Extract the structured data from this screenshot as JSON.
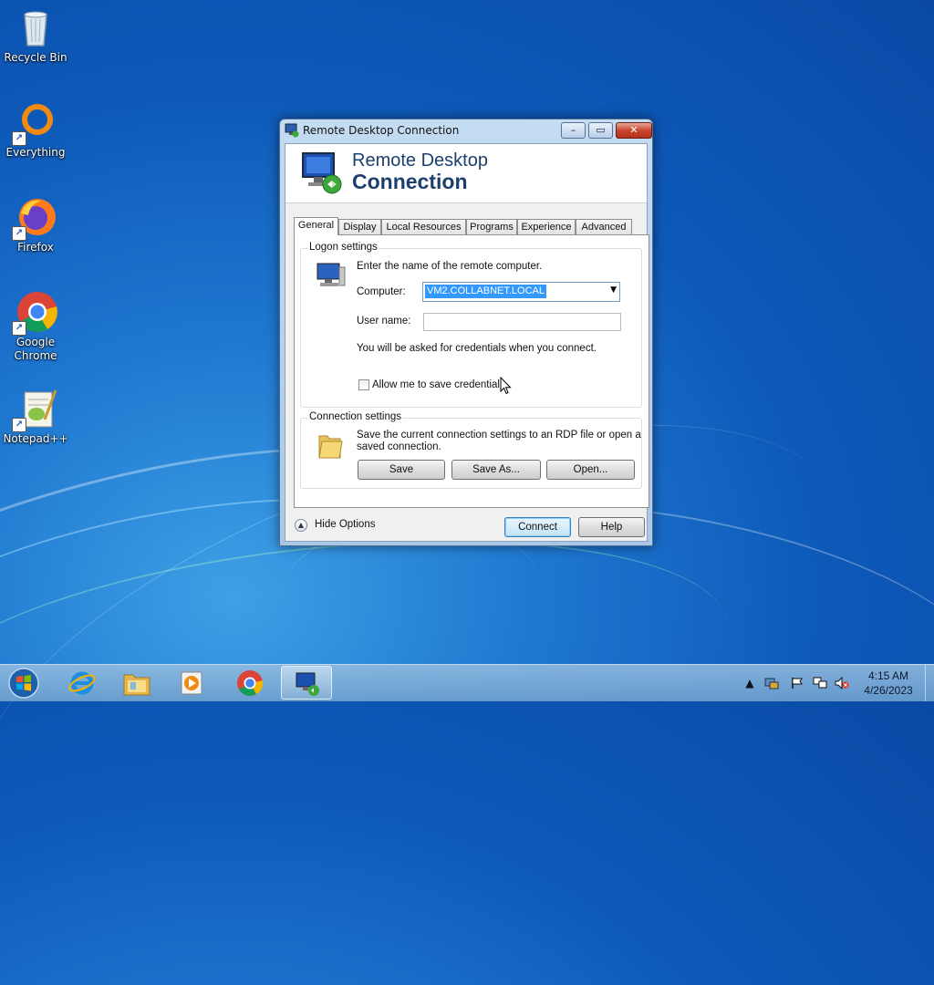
{
  "desktop": {
    "icons": [
      {
        "label": "Recycle Bin"
      },
      {
        "label": "Everything"
      },
      {
        "label": "Firefox"
      },
      {
        "label": "Google Chrome"
      },
      {
        "label": "Notepad++"
      }
    ]
  },
  "window": {
    "title": "Remote Desktop Connection",
    "minimize_glyph": "–",
    "maximize_glyph": "▭",
    "close_glyph": "✕",
    "banner_line1": "Remote Desktop",
    "banner_line2": "Connection",
    "tabs": [
      {
        "label": "General",
        "active": true
      },
      {
        "label": "Display"
      },
      {
        "label": "Local Resources"
      },
      {
        "label": "Programs"
      },
      {
        "label": "Experience"
      },
      {
        "label": "Advanced"
      }
    ],
    "logon": {
      "group_label": "Logon settings",
      "instruction": "Enter the name of the remote computer.",
      "computer_label": "Computer:",
      "computer_value": "VM2.COLLABNET.LOCAL",
      "username_label": "User name:",
      "username_value": "",
      "credentials_note": "You will be asked for credentials when you connect.",
      "allow_save_label": "Allow me to save credentials",
      "allow_save_checked": false
    },
    "connection": {
      "group_label": "Connection settings",
      "description_line1": "Save the current connection settings to an RDP file or open a",
      "description_line2": "saved connection.",
      "save_label": "Save",
      "save_as_label": "Save As...",
      "open_label": "Open..."
    },
    "hide_options_label": "Hide Options",
    "connect_label": "Connect",
    "help_label": "Help"
  },
  "taskbar": {
    "pinned": [
      "start-orb",
      "internet-explorer",
      "windows-explorer",
      "media-player",
      "google-chrome",
      "remote-desktop-connection"
    ],
    "tray_up_glyph": "▲",
    "clock_time": "4:15 AM",
    "clock_date": "4/26/2023"
  },
  "colors": {
    "desktop_blue": "#1f78d0",
    "selection": "#3399ff",
    "banner_text": "#1d3f6e",
    "close_red": "#c8452f"
  }
}
